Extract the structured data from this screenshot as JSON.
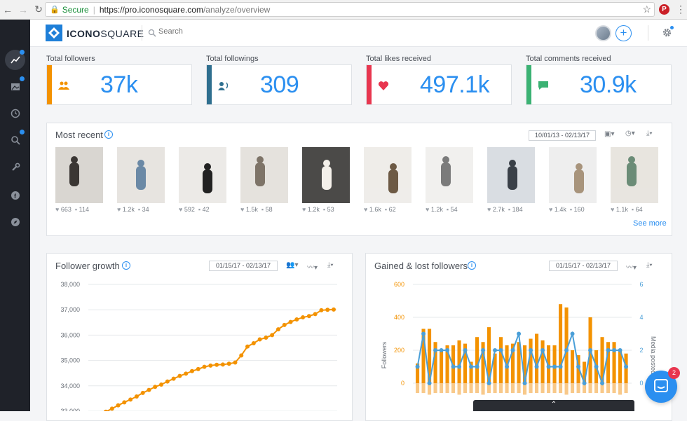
{
  "browser": {
    "secure_label": "Secure",
    "url_host": "https://pro.iconosquare.com",
    "url_path": "/analyze/overview"
  },
  "header": {
    "logo_bold": "ICONO",
    "logo_rest": "SQUARE",
    "search_placeholder": "Search"
  },
  "kpis": [
    {
      "label": "Total followers",
      "value": "37k",
      "color": "#f39200",
      "icon": "people-icon"
    },
    {
      "label": "Total followings",
      "value": "309",
      "color": "#2f6f8f",
      "icon": "speaker-icon"
    },
    {
      "label": "Total likes received",
      "value": "497.1k",
      "color": "#e8364f",
      "icon": "heart-icon"
    },
    {
      "label": "Total comments received",
      "value": "30.9k",
      "color": "#3bb273",
      "icon": "comment-icon"
    }
  ],
  "most_recent": {
    "title": "Most recent",
    "date_range": "10/01/13 - 02/13/17",
    "see_more": "See more",
    "posts": [
      {
        "likes": "663",
        "comments": "114"
      },
      {
        "likes": "1.2k",
        "comments": "34"
      },
      {
        "likes": "592",
        "comments": "42"
      },
      {
        "likes": "1.5k",
        "comments": "58"
      },
      {
        "likes": "1.2k",
        "comments": "53"
      },
      {
        "likes": "1.6k",
        "comments": "62"
      },
      {
        "likes": "1.2k",
        "comments": "54"
      },
      {
        "likes": "2.7k",
        "comments": "184"
      },
      {
        "likes": "1.4k",
        "comments": "160"
      },
      {
        "likes": "1.1k",
        "comments": "64"
      }
    ]
  },
  "follower_growth": {
    "title": "Follower growth",
    "date_range": "01/15/17 - 02/13/17"
  },
  "gained_lost": {
    "title": "Gained & lost followers",
    "date_range": "01/15/17 - 02/13/17"
  },
  "chat": {
    "badge": "2"
  },
  "scroll_tab": {
    "label": "⌃"
  },
  "chart_data": [
    {
      "type": "line",
      "title": "Follower growth",
      "yticks": [
        "38,000",
        "37,000",
        "36,000",
        "35,000",
        "34,000",
        "33,000"
      ],
      "ylim": [
        33000,
        38000
      ],
      "color": "#f39200",
      "y": [
        32980,
        33100,
        33230,
        33350,
        33460,
        33580,
        33720,
        33840,
        33960,
        34050,
        34170,
        34280,
        34390,
        34480,
        34580,
        34660,
        34750,
        34800,
        34830,
        34840,
        34870,
        34920,
        35200,
        35550,
        35680,
        35830,
        35900,
        36000,
        36230,
        36400,
        36520,
        36620,
        36700,
        36750,
        36830,
        36980,
        37000,
        37010
      ]
    },
    {
      "type": "bar",
      "title": "Gained & lost followers",
      "ylabel": "Followers",
      "y2label": "Media posted",
      "yticks": [
        "600",
        "400",
        "200",
        "0"
      ],
      "y2ticks": [
        "6",
        "4",
        "2",
        "0"
      ],
      "ylim": [
        -100,
        600
      ],
      "y2lim": [
        -0.5,
        6
      ],
      "gained": [
        120,
        330,
        330,
        250,
        200,
        230,
        230,
        260,
        240,
        130,
        280,
        250,
        340,
        180,
        280,
        230,
        240,
        250,
        230,
        270,
        300,
        260,
        230,
        230,
        480,
        460,
        200,
        170,
        130,
        400,
        200,
        280,
        250,
        250,
        200,
        180
      ],
      "lost": [
        -60,
        -60,
        -70,
        -60,
        -60,
        -60,
        -60,
        -70,
        -60,
        -60,
        -60,
        -70,
        -60,
        -60,
        -60,
        -60,
        -60,
        -60,
        -70,
        -60,
        -60,
        -60,
        -60,
        -60,
        -60,
        -70,
        -60,
        -60,
        -60,
        -60,
        -60,
        -60,
        -60,
        -60,
        -70,
        -60
      ],
      "media": [
        1,
        3,
        0,
        2,
        2,
        2,
        1,
        1,
        2,
        1,
        1,
        2,
        0,
        2,
        2,
        1,
        2,
        3,
        0,
        2,
        1,
        2,
        1,
        1,
        1,
        2,
        3,
        1,
        0,
        2,
        1,
        0,
        2,
        2,
        2,
        1
      ],
      "gained_color": "#f39200",
      "lost_color": "#f8c98a",
      "media_color": "#4a9fd8"
    }
  ]
}
